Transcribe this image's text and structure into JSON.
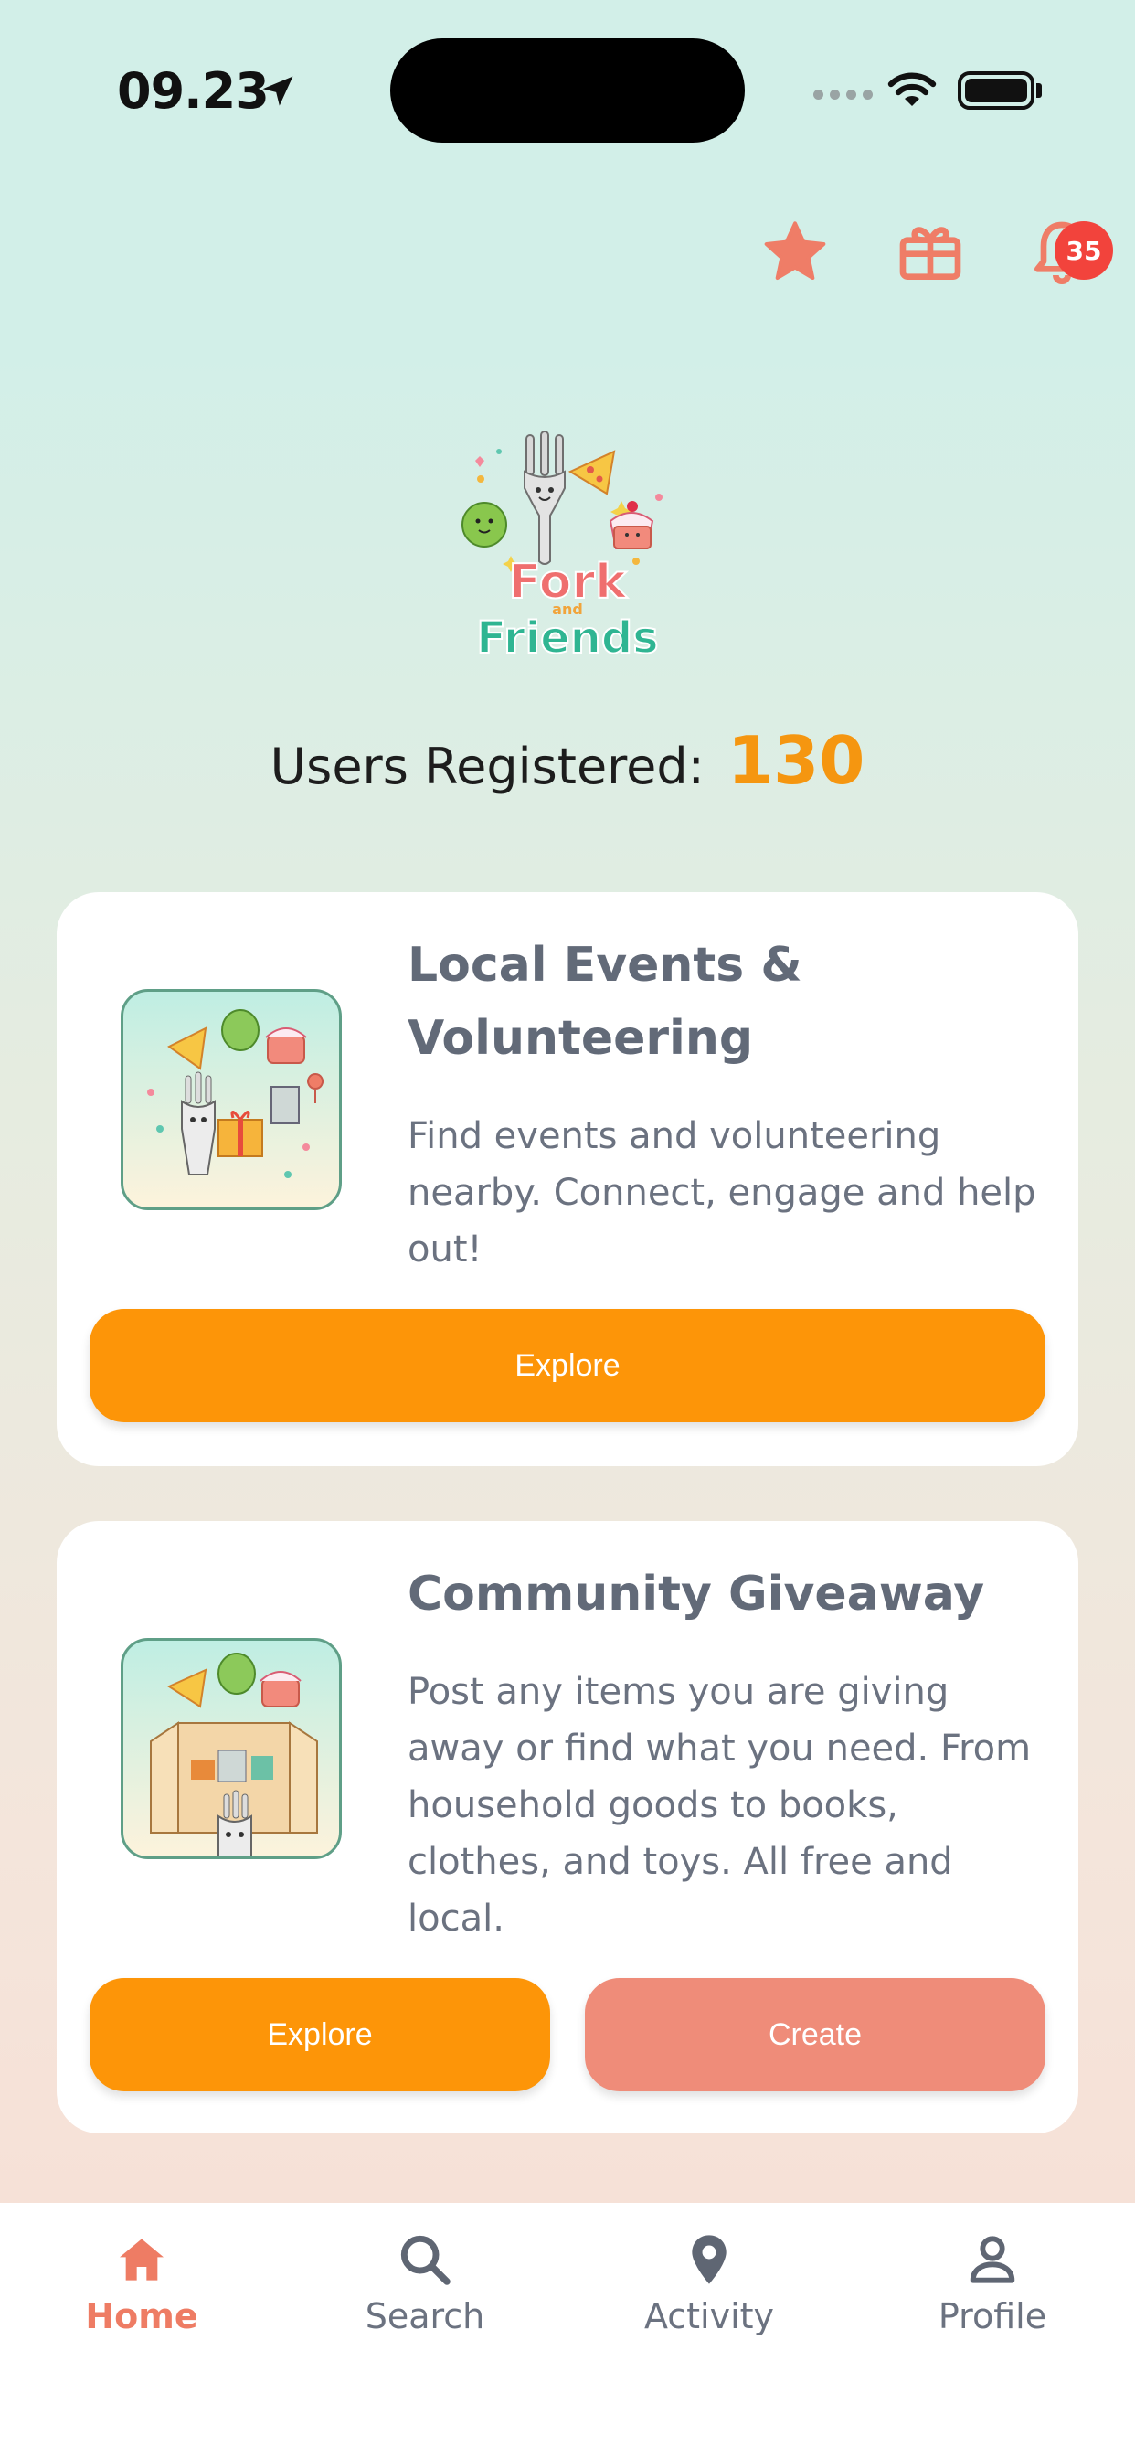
{
  "status_bar": {
    "time": "09.23"
  },
  "header": {
    "notification_count": "35"
  },
  "stats": {
    "label": "Users Registered:",
    "count": "130"
  },
  "cards": [
    {
      "title": "Local Events & Volunteering",
      "description": "Find events and volunteering nearby. Connect, engage and help out!",
      "explore_label": "Explore"
    },
    {
      "title": "Community Giveaway",
      "description": "Post any items you are giving away or find what you need. From household goods to books, clothes, and toys. All free and local.",
      "explore_label": "Explore",
      "create_label": "Create"
    }
  ],
  "tabbar": {
    "home": "Home",
    "search": "Search",
    "activity": "Activity",
    "profile": "Profile"
  },
  "colors": {
    "accent": "#fd9508",
    "secondary": "#ef8c79",
    "badge": "#f2433c",
    "brand_teal": "#2fb592"
  },
  "icons": [
    "location-arrow-icon",
    "wifi-icon",
    "battery-icon",
    "star-icon",
    "gift-icon",
    "bell-icon",
    "home-icon",
    "search-icon",
    "location-pin-icon",
    "person-icon"
  ]
}
